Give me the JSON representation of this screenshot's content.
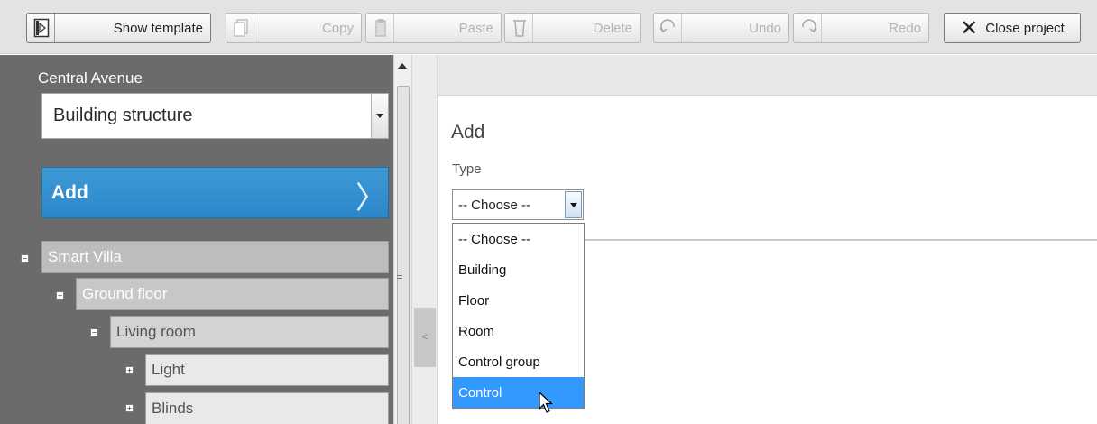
{
  "toolbar": {
    "show_template": "Show template",
    "copy": "Copy",
    "paste": "Paste",
    "delete": "Delete",
    "undo": "Undo",
    "redo": "Redo",
    "close_project": "Close project"
  },
  "sidebar": {
    "project_name": "Central Avenue",
    "view_select": "Building structure",
    "add_label": "Add",
    "tree": [
      {
        "label": "Smart Villa",
        "toggle": "−"
      },
      {
        "label": "Ground floor",
        "toggle": "−"
      },
      {
        "label": "Living room",
        "toggle": "−"
      },
      {
        "label": "Light",
        "toggle": "+"
      },
      {
        "label": "Blinds",
        "toggle": "+"
      }
    ]
  },
  "main": {
    "title": "Add",
    "type_label": "Type",
    "type_value": "-- Choose --",
    "options": [
      "-- Choose --",
      "Building",
      "Floor",
      "Room",
      "Control group",
      "Control"
    ],
    "selected_option": "Control",
    "highlight_color": "#3399ff"
  },
  "colors": {
    "sidebar_bg": "#6b6b6b",
    "add_bar": "#2c87c9",
    "toolbar_bg": "#e3e3e3"
  }
}
